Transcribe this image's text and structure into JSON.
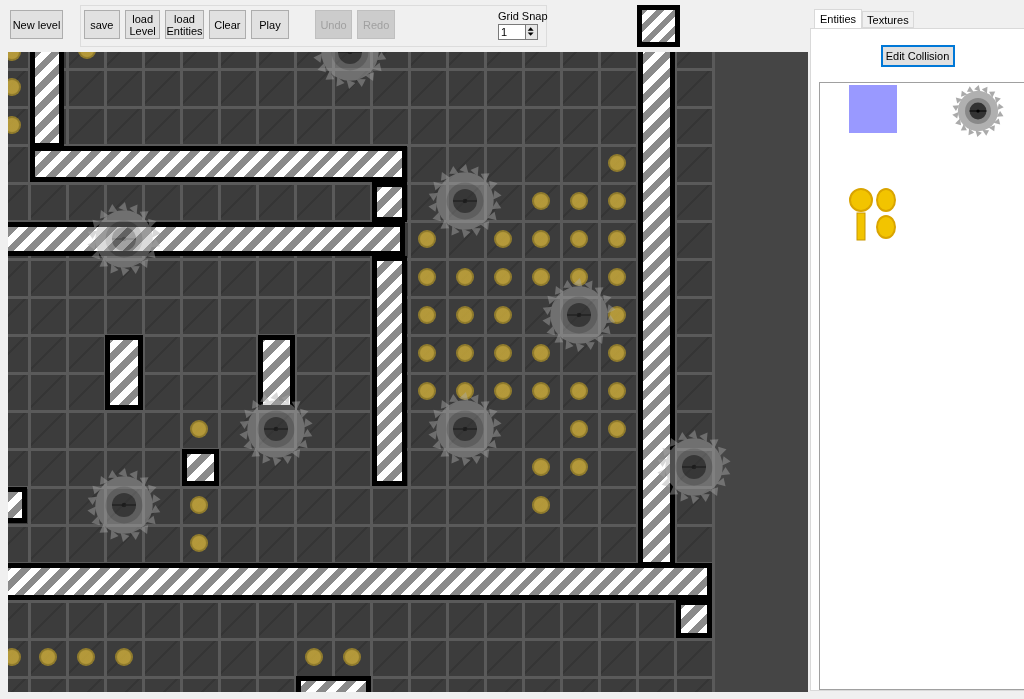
{
  "toolbar": {
    "new_level_button": {
      "label": "New level",
      "disabled": false
    },
    "actions": [
      {
        "label": "save",
        "disabled": false
      },
      {
        "label": "load Level",
        "disabled": false
      },
      {
        "label": "load Entities",
        "disabled": false
      },
      {
        "label": "Clear",
        "disabled": false
      },
      {
        "label": "Play",
        "disabled": false
      },
      {
        "label": "Undo",
        "disabled": true
      },
      {
        "label": "Redo",
        "disabled": true
      }
    ],
    "grid_snap": {
      "label": "Grid Snap",
      "value": "1"
    }
  },
  "side_panel": {
    "tabs": [
      {
        "label": "Entities",
        "selected": true
      },
      {
        "label": "Textures",
        "selected": false
      }
    ],
    "edit_collision_button": "Edit Collision"
  }
}
